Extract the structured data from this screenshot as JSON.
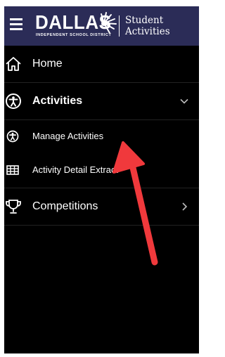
{
  "header": {
    "logo_text": "DALLAS",
    "logo_subtext": "INDEPENDENT SCHOOL DISTRICT",
    "title_line1": "Student",
    "title_line2": "Activities",
    "color": "#2b2c57"
  },
  "nav": {
    "home": {
      "label": "Home",
      "icon": "home-icon"
    },
    "activities": {
      "label": "Activities",
      "icon": "accessibility-icon",
      "expanded": true
    },
    "manage_activities": {
      "label": "Manage Activities",
      "icon": "accessibility-icon"
    },
    "activity_detail_extract": {
      "label": "Activity Detail Extract",
      "icon": "table-icon"
    },
    "competitions": {
      "label": "Competitions",
      "icon": "trophy-icon"
    }
  },
  "annotation": {
    "arrow_color": "#f0393c"
  }
}
